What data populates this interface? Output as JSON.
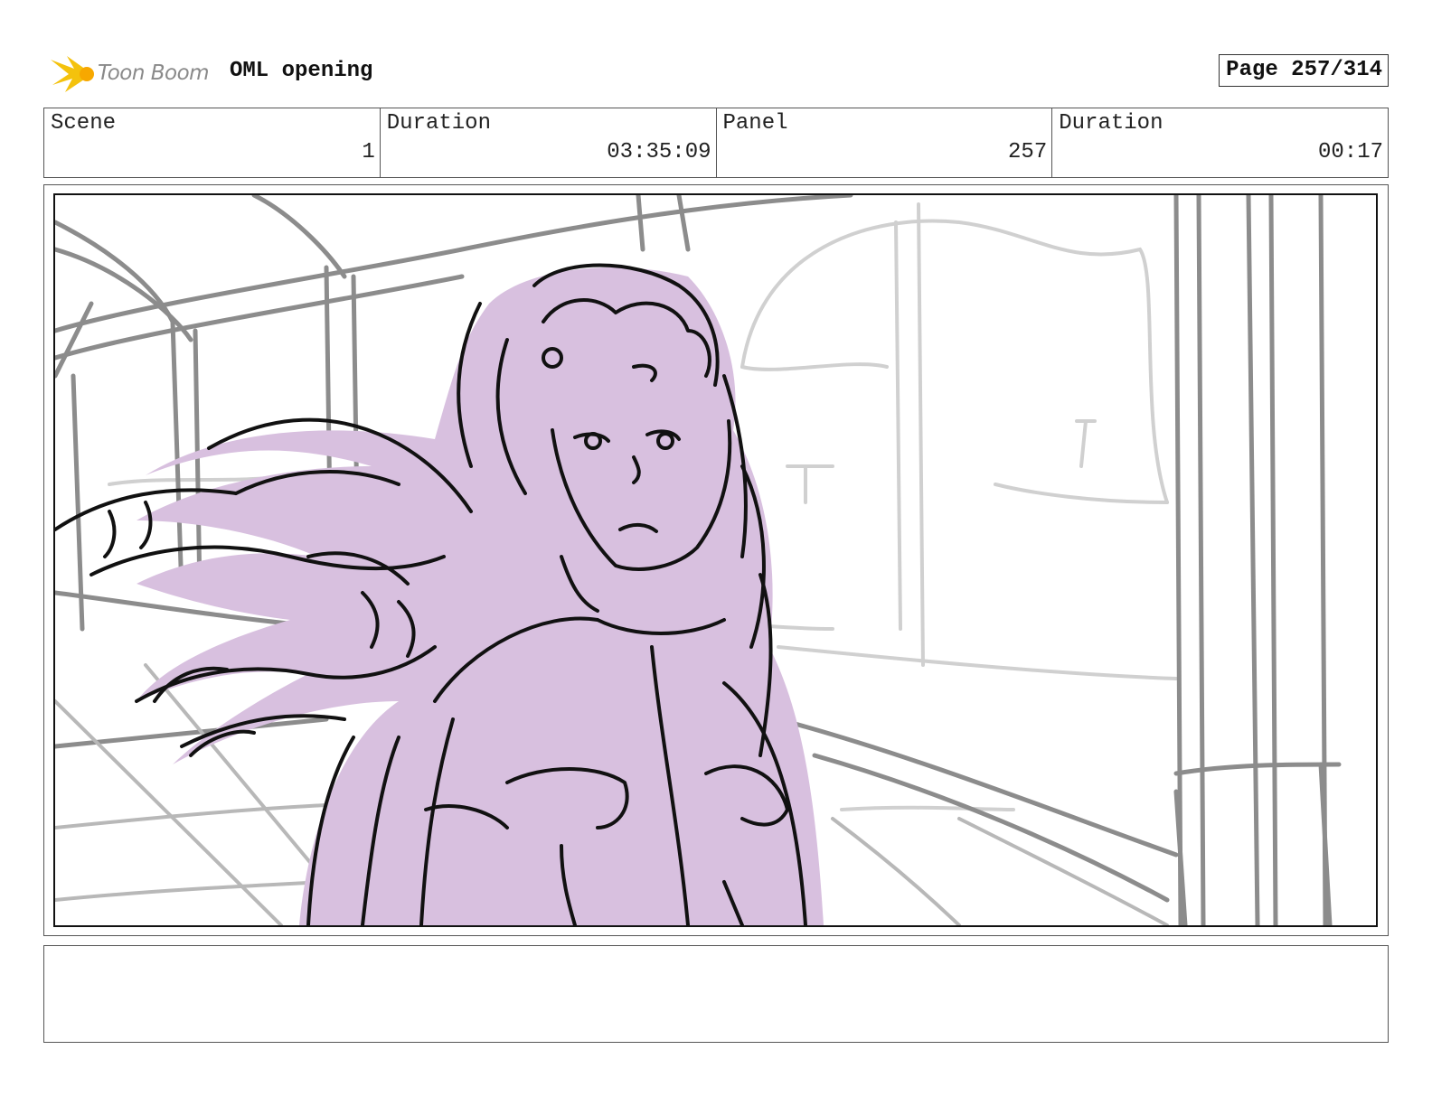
{
  "header": {
    "brand": "Toon Boom",
    "project_title": "OML opening",
    "page_indicator": "Page 257/314"
  },
  "info": {
    "scene_label": "Scene",
    "scene_value": "1",
    "scene_duration_label": "Duration",
    "scene_duration_value": "03:35:09",
    "panel_label": "Panel",
    "panel_value": "257",
    "panel_duration_label": "Duration",
    "panel_duration_value": "00:17"
  },
  "colors": {
    "logo_yellow": "#f4c20d",
    "character_fill": "#d8c0df",
    "background_lines": "#8c8c8c",
    "faint_lines": "#d0d0d0",
    "ink": "#111111"
  },
  "notes": {
    "text": ""
  }
}
